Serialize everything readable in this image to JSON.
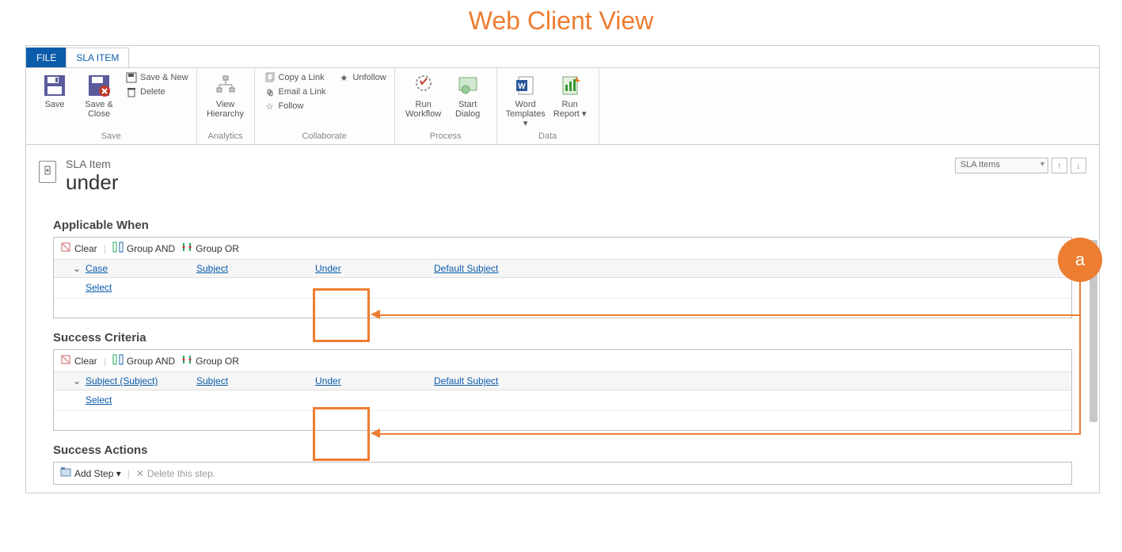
{
  "annotation": {
    "title": "Web Client View",
    "badge": "a"
  },
  "tabs": {
    "file": "FILE",
    "sla_item": "SLA ITEM"
  },
  "ribbon": {
    "save": {
      "save": "Save",
      "save_close": "Save &\nClose",
      "save_new": "Save & New",
      "delete": "Delete",
      "group": "Save"
    },
    "analytics": {
      "view_hierarchy": "View\nHierarchy",
      "group": "Analytics"
    },
    "collaborate": {
      "copy_link": "Copy a Link",
      "email_link": "Email a Link",
      "follow": "Follow",
      "unfollow": "Unfollow",
      "group": "Collaborate"
    },
    "process": {
      "run_workflow": "Run\nWorkflow",
      "start_dialog": "Start\nDialog",
      "group": "Process"
    },
    "data": {
      "word_templates": "Word\nTemplates ▾",
      "run_report": "Run\nReport ▾",
      "group": "Data"
    }
  },
  "header": {
    "entity_type": "SLA Item",
    "entity_name": "under",
    "picker": "SLA Items"
  },
  "sections": {
    "applicable": {
      "title": "Applicable When",
      "toolbar": {
        "clear": "Clear",
        "group_and": "Group AND",
        "group_or": "Group OR"
      },
      "row": {
        "entity": "Case",
        "attribute": "Subject",
        "operator": "Under",
        "value": "Default Subject"
      },
      "select": "Select"
    },
    "success": {
      "title": "Success Criteria",
      "toolbar": {
        "clear": "Clear",
        "group_and": "Group AND",
        "group_or": "Group OR"
      },
      "row": {
        "entity": "Subject (Subject)",
        "attribute": "Subject",
        "operator": "Under",
        "value": "Default Subject"
      },
      "select": "Select"
    },
    "actions": {
      "title": "Success Actions",
      "add_step": "Add Step ▾",
      "delete_step": "Delete this step."
    }
  }
}
